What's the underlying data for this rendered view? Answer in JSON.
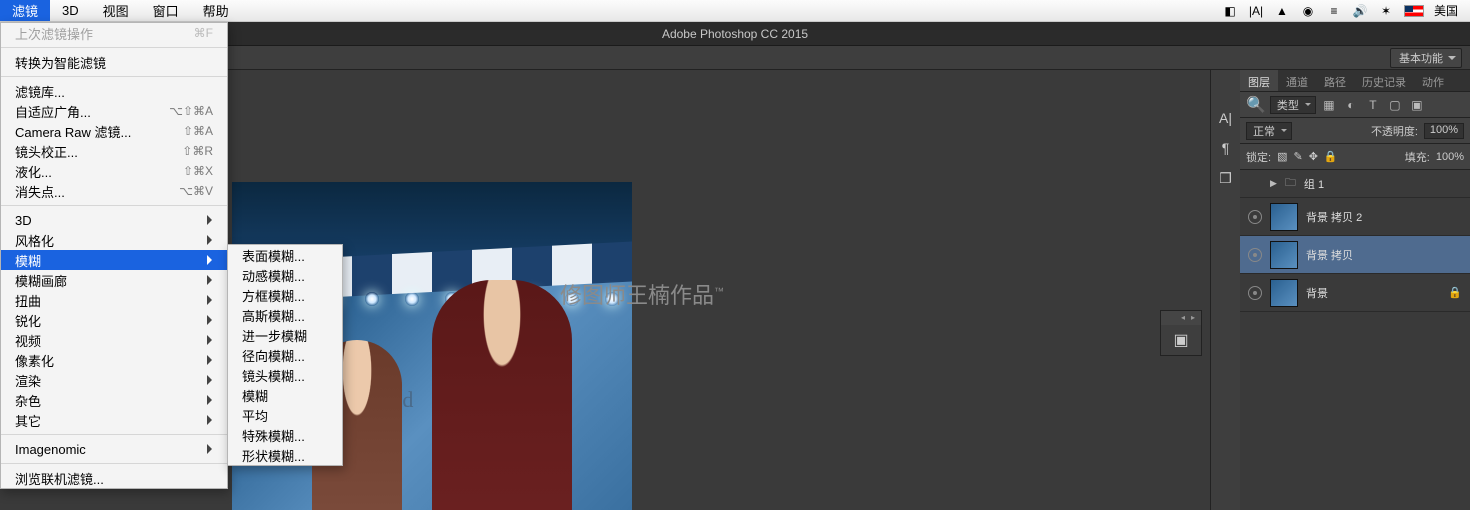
{
  "menubar": {
    "items": [
      "滤镜",
      "3D",
      "视图",
      "窗口",
      "帮助"
    ],
    "active_index": 0,
    "locale": "美国"
  },
  "titlebar": "Adobe Photoshop CC 2015",
  "workspace": "基本功能",
  "filter_menu": {
    "last_filter": {
      "label": "上次滤镜操作",
      "shortcut": "⌘F",
      "disabled": true
    },
    "convert_smart": "转换为智能滤镜",
    "group1": [
      {
        "label": "滤镜库..."
      },
      {
        "label": "自适应广角...",
        "shortcut": "⌥⇧⌘A"
      },
      {
        "label": "Camera Raw 滤镜...",
        "shortcut": "⇧⌘A"
      },
      {
        "label": "镜头校正...",
        "shortcut": "⇧⌘R"
      },
      {
        "label": "液化...",
        "shortcut": "⇧⌘X"
      },
      {
        "label": "消失点...",
        "shortcut": "⌥⌘V"
      }
    ],
    "group2": [
      {
        "label": "3D",
        "submenu": true
      },
      {
        "label": "风格化",
        "submenu": true
      },
      {
        "label": "模糊",
        "submenu": true,
        "highlight": true
      },
      {
        "label": "模糊画廊",
        "submenu": true
      },
      {
        "label": "扭曲",
        "submenu": true
      },
      {
        "label": "锐化",
        "submenu": true
      },
      {
        "label": "视频",
        "submenu": true
      },
      {
        "label": "像素化",
        "submenu": true
      },
      {
        "label": "渲染",
        "submenu": true
      },
      {
        "label": "杂色",
        "submenu": true
      },
      {
        "label": "其它",
        "submenu": true
      }
    ],
    "group3": [
      {
        "label": "Imagenomic",
        "submenu": true
      }
    ],
    "browse": "浏览联机滤镜..."
  },
  "blur_submenu": [
    "表面模糊...",
    "动感模糊...",
    "方框模糊...",
    "高斯模糊...",
    "进一步模糊",
    "径向模糊...",
    "镜头模糊...",
    "模糊",
    "平均",
    "特殊模糊...",
    "形状模糊..."
  ],
  "watermark": "修图师王楠作品",
  "watermark_tm": "™",
  "canvas_sign": "Mand",
  "panels": {
    "tabs": [
      "图层",
      "通道",
      "路径",
      "历史记录",
      "动作"
    ],
    "active_tab": 0,
    "kind_filter": "类型",
    "blend_mode": "正常",
    "opacity_label": "不透明度:",
    "opacity_value": "100%",
    "lock_label": "锁定:",
    "fill_label": "填充:",
    "fill_value": "100%"
  },
  "layers": [
    {
      "name": "组 1",
      "type": "group",
      "visible": false
    },
    {
      "name": "背景 拷贝 2",
      "type": "layer",
      "visible": true
    },
    {
      "name": "背景 拷贝",
      "type": "layer",
      "visible": true,
      "selected": true
    },
    {
      "name": "背景",
      "type": "layer",
      "visible": true,
      "locked": true
    }
  ]
}
